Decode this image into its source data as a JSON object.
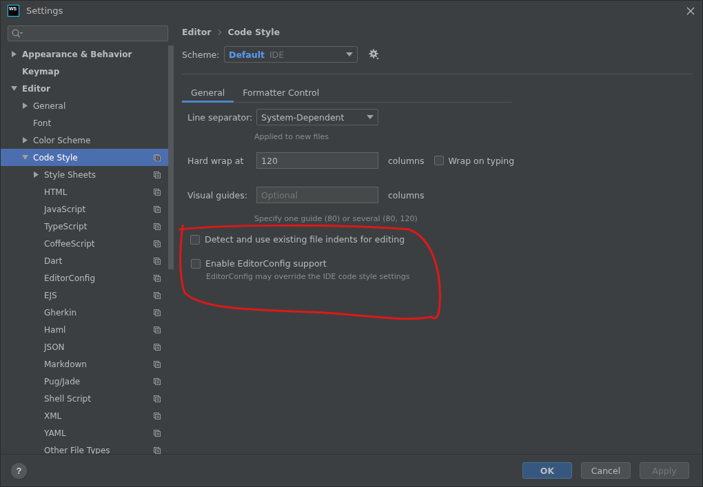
{
  "window": {
    "title": "Settings",
    "logo": "WS"
  },
  "sidebar": {
    "tree": [
      {
        "label": "Appearance & Behavior",
        "bold": true,
        "expanded": false,
        "selected": false,
        "project_level": false
      },
      {
        "label": "Keymap",
        "bold": true,
        "selected": false,
        "project_level": false
      },
      {
        "label": "Editor",
        "bold": true,
        "expanded": true,
        "selected": false,
        "project_level": false,
        "children": [
          {
            "label": "General",
            "bold": false,
            "expanded": false,
            "selected": false,
            "project_level": false
          },
          {
            "label": "Font",
            "bold": false,
            "selected": false,
            "project_level": false
          },
          {
            "label": "Color Scheme",
            "bold": false,
            "expanded": false,
            "selected": false,
            "project_level": false
          },
          {
            "label": "Code Style",
            "bold": false,
            "expanded": true,
            "selected": true,
            "project_level": true,
            "children": [
              {
                "label": "Style Sheets",
                "bold": false,
                "expanded": false,
                "selected": false,
                "project_level": true
              },
              {
                "label": "HTML",
                "bold": false,
                "selected": false,
                "project_level": true
              },
              {
                "label": "JavaScript",
                "bold": false,
                "selected": false,
                "project_level": true
              },
              {
                "label": "TypeScript",
                "bold": false,
                "selected": false,
                "project_level": true
              },
              {
                "label": "CoffeeScript",
                "bold": false,
                "selected": false,
                "project_level": true
              },
              {
                "label": "Dart",
                "bold": false,
                "selected": false,
                "project_level": true
              },
              {
                "label": "EditorConfig",
                "bold": false,
                "selected": false,
                "project_level": true
              },
              {
                "label": "EJS",
                "bold": false,
                "selected": false,
                "project_level": true
              },
              {
                "label": "Gherkin",
                "bold": false,
                "selected": false,
                "project_level": true
              },
              {
                "label": "Haml",
                "bold": false,
                "selected": false,
                "project_level": true
              },
              {
                "label": "JSON",
                "bold": false,
                "selected": false,
                "project_level": true
              },
              {
                "label": "Markdown",
                "bold": false,
                "selected": false,
                "project_level": true
              },
              {
                "label": "Pug/Jade",
                "bold": false,
                "selected": false,
                "project_level": true
              },
              {
                "label": "Shell Script",
                "bold": false,
                "selected": false,
                "project_level": true
              },
              {
                "label": "XML",
                "bold": false,
                "selected": false,
                "project_level": true
              },
              {
                "label": "YAML",
                "bold": false,
                "selected": false,
                "project_level": true
              },
              {
                "label": "Other File Types",
                "bold": false,
                "selected": false,
                "project_level": true
              }
            ]
          }
        ]
      }
    ]
  },
  "breadcrumb": [
    "Editor",
    "Code Style"
  ],
  "scheme": {
    "label": "Scheme:",
    "name": "Default",
    "type": "IDE"
  },
  "tabs": [
    {
      "label": "General",
      "selected": true
    },
    {
      "label": "Formatter Control",
      "selected": false
    }
  ],
  "form": {
    "line_separator": {
      "label": "Line separator:",
      "value": "System-Dependent",
      "hint": "Applied to new files"
    },
    "hard_wrap": {
      "label": "Hard wrap at",
      "value": "120",
      "unit": "columns",
      "wrap_on_typing": {
        "label": "Wrap on typing",
        "checked": false
      }
    },
    "visual_guides": {
      "label": "Visual guides:",
      "placeholder": "Optional",
      "unit": "columns",
      "hint": "Specify one guide (80) or several (80, 120)"
    },
    "options": [
      {
        "label": "Detect and use existing file indents for editing",
        "checked": false
      },
      {
        "label": "Enable EditorConfig support",
        "checked": false,
        "hint": "EditorConfig may override the IDE code style settings"
      }
    ]
  },
  "footer": {
    "help": "?",
    "buttons": [
      {
        "label": "OK",
        "kind": "primary",
        "disabled": false
      },
      {
        "label": "Cancel",
        "kind": "normal",
        "disabled": false
      },
      {
        "label": "Apply",
        "kind": "normal",
        "disabled": true
      }
    ]
  }
}
